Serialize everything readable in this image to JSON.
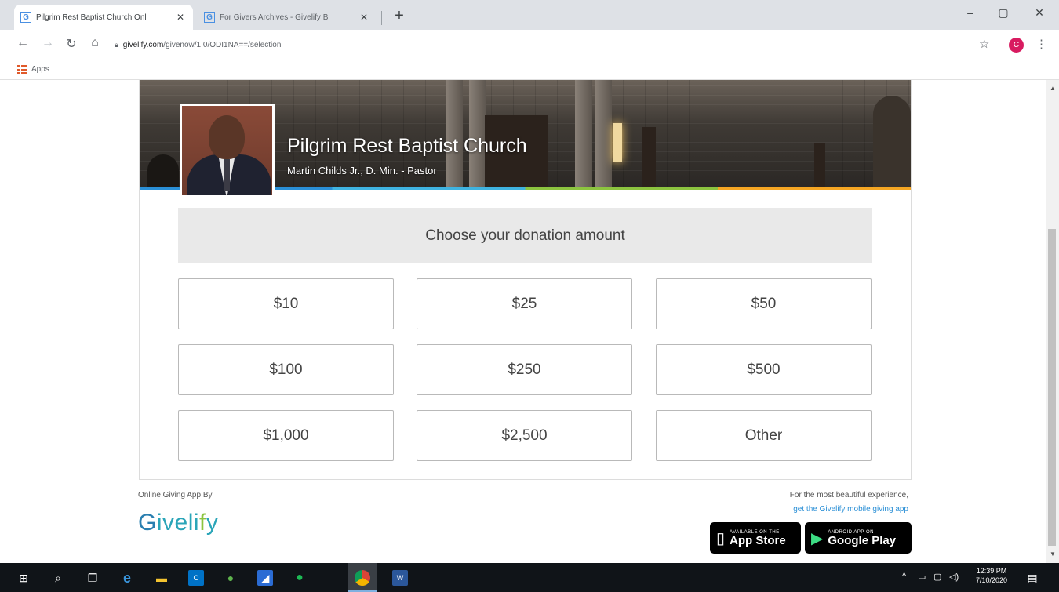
{
  "browser": {
    "tabs": [
      {
        "title": "Pilgrim Rest Baptist Church Onl",
        "favicon": "G",
        "active": true
      },
      {
        "title": "For Givers Archives - Givelify Bl",
        "favicon": "G",
        "active": false
      }
    ],
    "new_tab_label": "+",
    "controls": {
      "minimize": "–",
      "maximize": "▢",
      "close": "✕"
    },
    "url_domain": "givelify.com",
    "url_path": "/givenow/1.0/ODI1NA==/selection",
    "profile_initial": "C",
    "bookmarks": {
      "apps_label": "Apps"
    }
  },
  "page": {
    "church_name": "Pilgrim Rest Baptist Church",
    "pastor": "Martin Childs Jr., D. Min. - Pastor",
    "prompt": "Choose your donation amount",
    "amounts": [
      "$10",
      "$25",
      "$50",
      "$100",
      "$250",
      "$500",
      "$1,000",
      "$2,500",
      "Other"
    ],
    "footer": {
      "left_label": "Online Giving App By",
      "brand": {
        "g": "G",
        "ive": "ive",
        "li": "li",
        "f": "f",
        "y": "y"
      },
      "right_line1": "For the most beautiful experience,",
      "right_line2": "get the Givelify mobile giving app",
      "app_store": {
        "small": "AVAILABLE ON THE",
        "big": "App Store"
      },
      "google_play": {
        "small": "ANDROID APP ON",
        "big": "Google Play"
      }
    }
  },
  "taskbar": {
    "clock_time": "12:39 PM",
    "clock_date": "7/10/2020"
  },
  "colors": {
    "brand_blue": "#2a8fd6",
    "brand_teal": "#2aa5b8",
    "brand_green": "#8cc43f",
    "accent_orange": "#f5a623"
  }
}
